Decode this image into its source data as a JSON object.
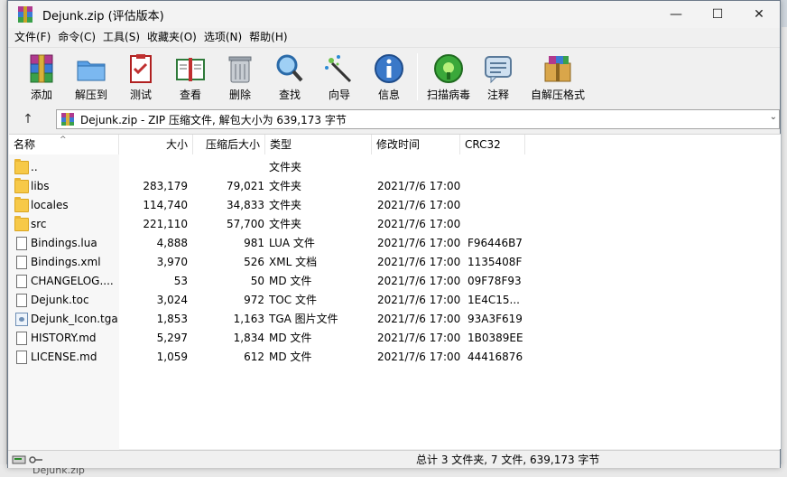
{
  "window": {
    "title": "Dejunk.zip (评估版本)",
    "controls": {
      "minimize": "—",
      "maximize": "☐",
      "close": "✕"
    }
  },
  "menu": [
    "文件(F)",
    "命令(C)",
    "工具(S)",
    "收藏夹(O)",
    "选项(N)",
    "帮助(H)"
  ],
  "toolbar": {
    "add": "添加",
    "extract_to": "解压到",
    "test": "测试",
    "view": "查看",
    "delete": "删除",
    "find": "查找",
    "wizard": "向导",
    "info": "信息",
    "virus_scan": "扫描病毒",
    "comment": "注释",
    "sfx": "自解压格式"
  },
  "address": {
    "up": "↑",
    "path": "Dejunk.zip - ZIP 压缩文件, 解包大小为 639,173 字节",
    "dropdown": "⌄"
  },
  "columns": {
    "name": "名称",
    "size": "大小",
    "packed": "压缩后大小",
    "type": "类型",
    "modified": "修改时间",
    "crc": "CRC32",
    "sort_indicator": "^"
  },
  "files": [
    {
      "icon": "folder-icon",
      "name": "..",
      "size": "",
      "packed": "",
      "type": "文件夹",
      "modified": "",
      "crc": ""
    },
    {
      "icon": "folder-icon",
      "name": "libs",
      "size": "283,179",
      "packed": "79,021",
      "type": "文件夹",
      "modified": "2021/7/6 17:00",
      "crc": ""
    },
    {
      "icon": "folder-icon",
      "name": "locales",
      "size": "114,740",
      "packed": "34,833",
      "type": "文件夹",
      "modified": "2021/7/6 17:00",
      "crc": ""
    },
    {
      "icon": "folder-icon",
      "name": "src",
      "size": "221,110",
      "packed": "57,700",
      "type": "文件夹",
      "modified": "2021/7/6 17:00",
      "crc": ""
    },
    {
      "icon": "file-icon",
      "name": "Bindings.lua",
      "size": "4,888",
      "packed": "981",
      "type": "LUA 文件",
      "modified": "2021/7/6 17:00",
      "crc": "F96446B7"
    },
    {
      "icon": "file-icon",
      "name": "Bindings.xml",
      "size": "3,970",
      "packed": "526",
      "type": "XML 文档",
      "modified": "2021/7/6 17:00",
      "crc": "1135408F"
    },
    {
      "icon": "file-icon",
      "name": "CHANGELOG....",
      "size": "53",
      "packed": "50",
      "type": "MD 文件",
      "modified": "2021/7/6 17:00",
      "crc": "09F78F93"
    },
    {
      "icon": "file-icon",
      "name": "Dejunk.toc",
      "size": "3,024",
      "packed": "972",
      "type": "TOC 文件",
      "modified": "2021/7/6 17:00",
      "crc": "1E4C15..."
    },
    {
      "icon": "image-file-icon",
      "name": "Dejunk_Icon.tga",
      "size": "1,853",
      "packed": "1,163",
      "type": "TGA 图片文件",
      "modified": "2021/7/6 17:00",
      "crc": "93A3F619"
    },
    {
      "icon": "file-icon",
      "name": "HISTORY.md",
      "size": "5,297",
      "packed": "1,834",
      "type": "MD 文件",
      "modified": "2021/7/6 17:00",
      "crc": "1B0389EE"
    },
    {
      "icon": "file-icon",
      "name": "LICENSE.md",
      "size": "1,059",
      "packed": "612",
      "type": "MD 文件",
      "modified": "2021/7/6 17:00",
      "crc": "44416876"
    }
  ],
  "status": {
    "summary": "总计 3 文件夹, 7 文件, 639,173 字节"
  },
  "background": {
    "taskbar_item": "Dejunk.zip"
  }
}
